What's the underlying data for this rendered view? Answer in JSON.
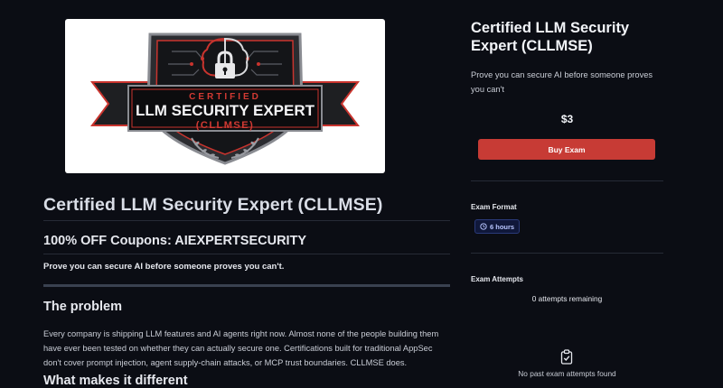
{
  "hero": {
    "alt": "Certified LLM Security Expert (CLLMSE) badge",
    "badge_line1": "CERTIFIED",
    "badge_line2": "LLM SECURITY EXPERT",
    "badge_line3": "(CLLMSE)"
  },
  "main": {
    "title": "Certified LLM Security Expert (CLLMSE)",
    "coupon": "100% OFF Coupons: AIEXPERTSECURITY",
    "lead": "Prove you can secure AI before someone proves you can't.",
    "section_problem": "The problem",
    "problem_text": "Every company is shipping LLM features and AI agents right now. Almost none of the people building them have ever been tested on whether they can actually secure one. Certifications built for traditional AppSec don't cover prompt injection, agent supply-chain attacks, or MCP trust boundaries. CLLMSE does.",
    "section_next": "What makes it different"
  },
  "sidebar": {
    "title": "Certified LLM Security Expert (CLLMSE)",
    "subtitle": "Prove you can secure AI before someone proves you can't",
    "price": "$3",
    "buy_label": "Buy Exam",
    "format_label": "Exam Format",
    "duration": "6 hours",
    "attempts_label": "Exam Attempts",
    "attempts_remaining": "0 attempts remaining",
    "no_past": "No past exam attempts found"
  },
  "colors": {
    "background": "#0b0d14",
    "accent": "#c73b35",
    "badge_bg": "#10183a",
    "badge_text": "#b9c6ff"
  },
  "icons": {
    "duration": "clock-icon",
    "empty_state": "clipboard-check-icon",
    "hero": "brain-lock-shield-icon"
  }
}
